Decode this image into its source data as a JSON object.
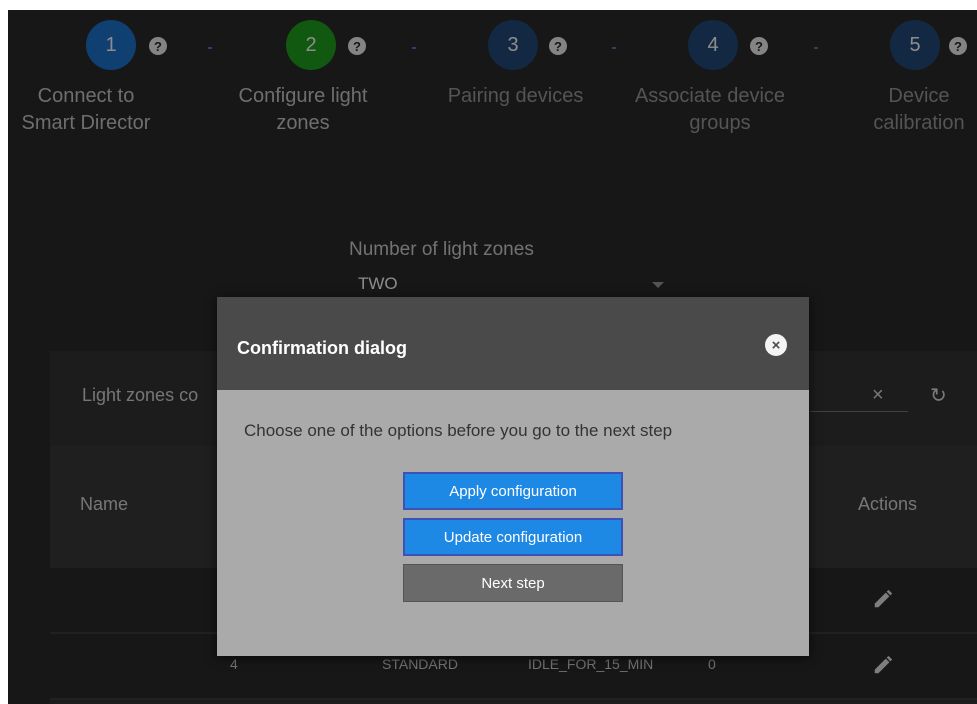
{
  "steps": [
    {
      "number": "1",
      "label_line1": "Connect to",
      "label_line2": "Smart Director",
      "color": "#1e74d0"
    },
    {
      "number": "2",
      "label_line1": "Configure light",
      "label_line2": "zones",
      "color": "#1fa01f"
    },
    {
      "number": "3",
      "label_line1": "Pairing devices",
      "label_line2": "",
      "color": "#244a7a"
    },
    {
      "number": "4",
      "label_line1": "Associate device",
      "label_line2": "groups",
      "color": "#244a7a"
    },
    {
      "number": "5",
      "label_line1": "Device",
      "label_line2": "calibration",
      "color": "#244a7a"
    }
  ],
  "help_glyph": "?",
  "zones": {
    "label": "Number of light zones",
    "value": "TWO"
  },
  "table": {
    "title": "Light zones co",
    "clear_glyph": "×",
    "refresh_glyph": "↻",
    "columns": {
      "name": "Name",
      "actions": "Actions"
    },
    "rows": [
      {
        "id": "",
        "type": "",
        "idle": "",
        "count": ""
      },
      {
        "id": "4",
        "type": "STANDARD",
        "idle": "IDLE_FOR_15_MIN",
        "count": "0"
      }
    ]
  },
  "dialog": {
    "title": "Confirmation dialog",
    "close_glyph": "×",
    "message": "Choose one of the options before you go to the next step",
    "buttons": {
      "apply": "Apply configuration",
      "update": "Update configuration",
      "next": "Next step"
    }
  },
  "colors": {
    "background": "#2b2b2b",
    "primary_button": "#1e88e5",
    "active_step": "#1fa01f",
    "completed_step": "#1e74d0",
    "pending_step": "#244a7a"
  }
}
